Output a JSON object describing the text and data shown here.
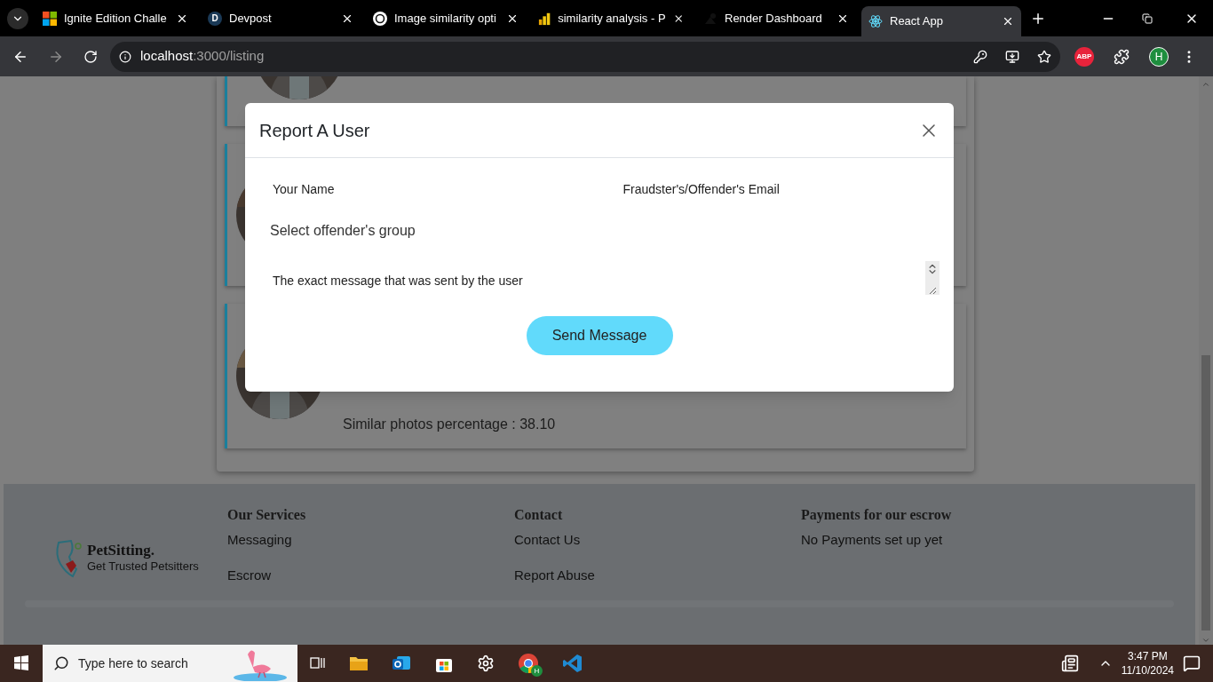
{
  "browser": {
    "tabs": [
      {
        "title": "Ignite Edition Challe",
        "selected": false,
        "kind": "windows"
      },
      {
        "title": "Devpost",
        "selected": false,
        "kind": "letter",
        "letter": "D"
      },
      {
        "title": "Image similarity opti",
        "selected": false,
        "kind": "knot"
      },
      {
        "title": "similarity analysis - P",
        "selected": false,
        "kind": "bars"
      },
      {
        "title": "Render Dashboard",
        "selected": false,
        "kind": "render"
      },
      {
        "title": "React App",
        "selected": true,
        "kind": "atom"
      }
    ],
    "url_host": "localhost",
    "url_rest": ":3000/listing",
    "extension_label": "ABP",
    "profile_initial": "H"
  },
  "listing": {
    "last_card_text": "Similar photos percentage : 38.10"
  },
  "modal": {
    "title": "Report A User",
    "name_placeholder": "Your Name",
    "email_placeholder": "Fraudster's/Offender's Email",
    "group_select": "Select offender's group",
    "message_placeholder": "The exact message that was sent by the user",
    "button": "Send Message"
  },
  "footer": {
    "logo_title": "PetSitting.",
    "logo_subtitle": "Get Trusted Petsitters",
    "columns": [
      {
        "heading": "Our Services",
        "links": [
          "Messaging",
          "Escrow"
        ]
      },
      {
        "heading": "Contact",
        "links": [
          "Contact Us",
          "Report Abuse"
        ]
      },
      {
        "heading": "Payments for our escrow",
        "links": [
          "No Payments set up yet"
        ]
      }
    ]
  },
  "taskbar": {
    "search_placeholder": "Type here to search",
    "time": "3:47 PM",
    "date": "11/10/2024",
    "chrome_badge": "H"
  }
}
